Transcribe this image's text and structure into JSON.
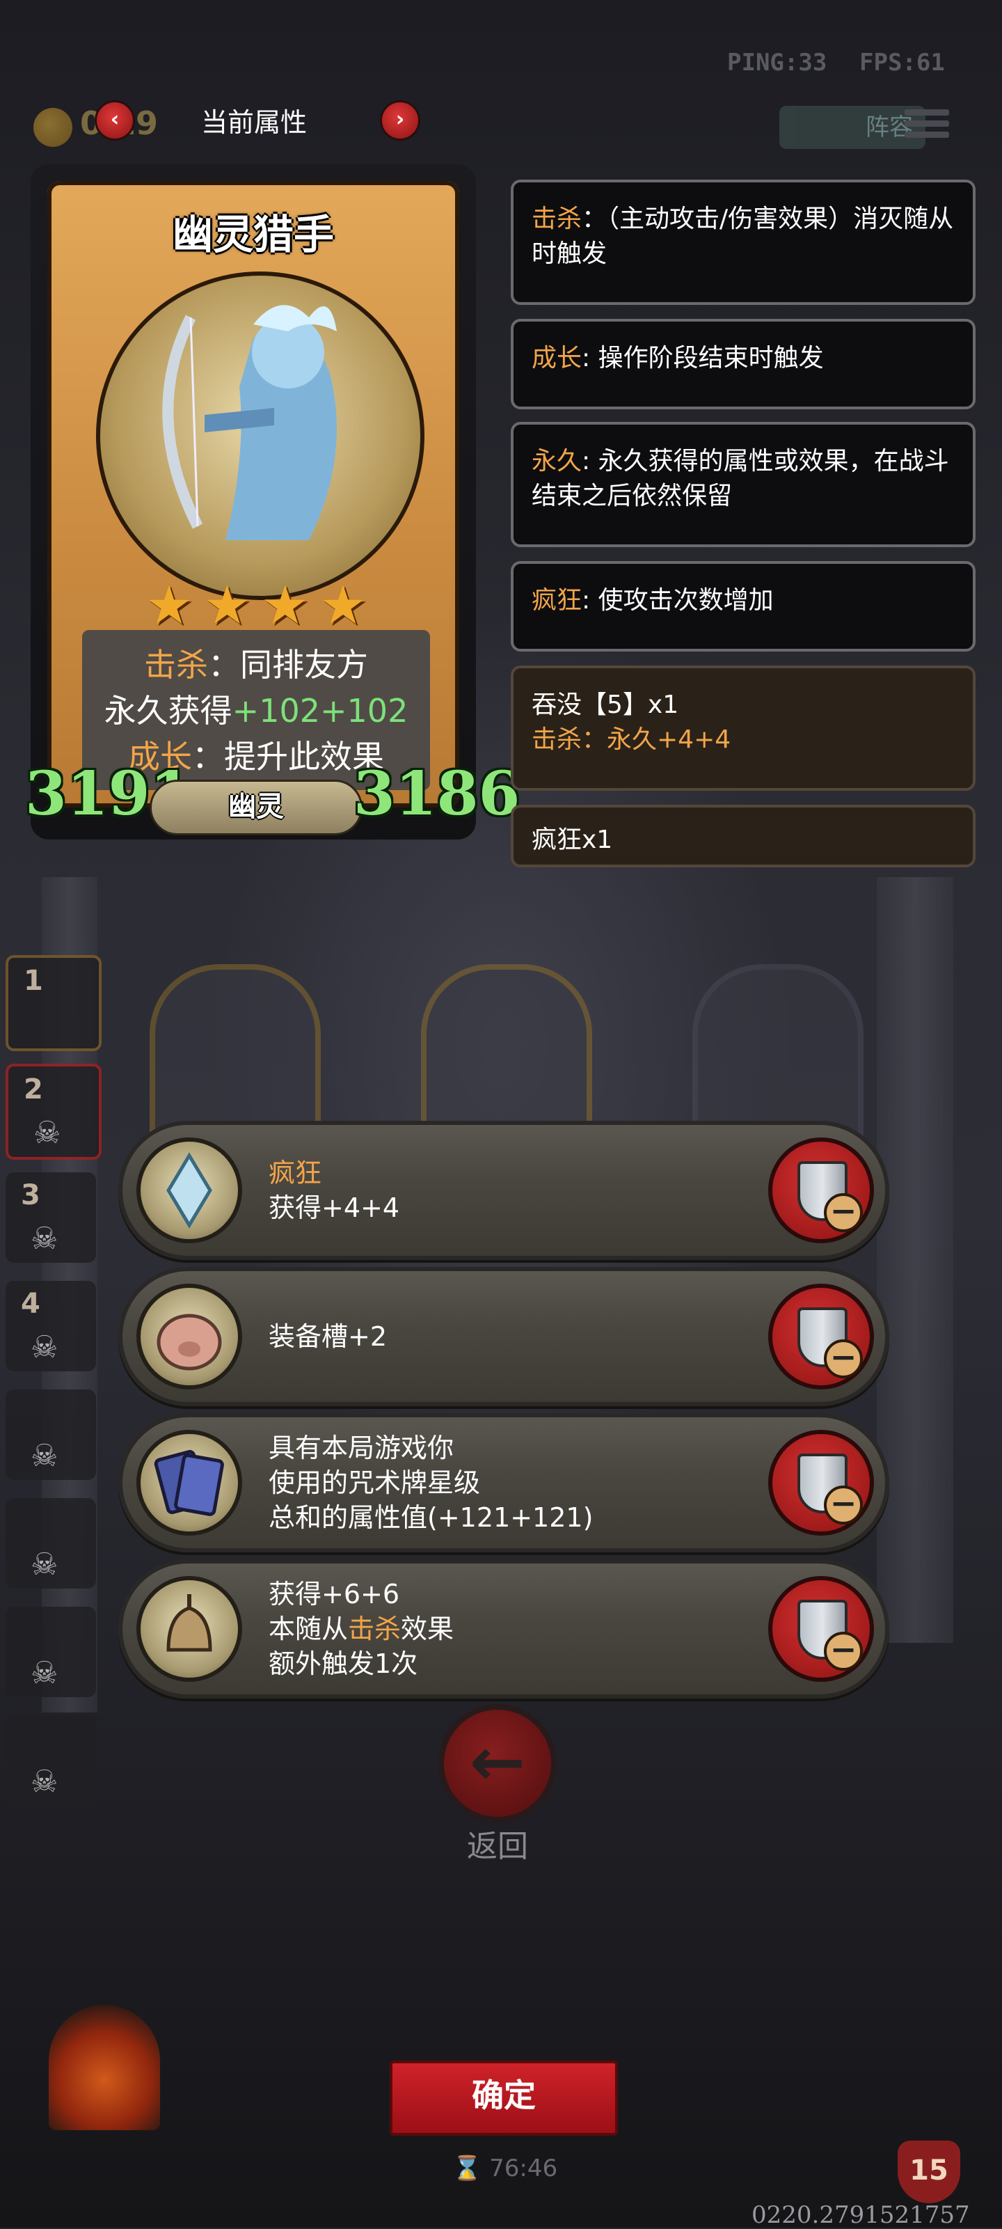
{
  "hud": {
    "ping": "PING:33",
    "fps": "FPS:61"
  },
  "header": {
    "gold": "0 19",
    "title": "当前属性",
    "prev_icon": "chevron-left-icon",
    "next_icon": "chevron-right-icon",
    "team_label": "阵容"
  },
  "card": {
    "name": "幽灵猎手",
    "stars": [
      "★",
      "★",
      "★",
      "★"
    ],
    "line1_kw": "击杀",
    "line1_rest": "：同排友方",
    "line2_a": "永久获得",
    "line2_b": "+102",
    "line2_c": "+102",
    "line3_kw": "成长",
    "line3_rest": "：提升此效果",
    "attack": "3191",
    "health": "3186",
    "tribe": "幽灵"
  },
  "glossary": [
    {
      "kw": "击杀",
      "text": "：（主动攻击/伤害效果）消灭随从时触发"
    },
    {
      "kw": "成长",
      "text": ": 操作阶段结束时触发"
    },
    {
      "kw": "永久",
      "text": ": 永久获得的属性或效果，在战斗结束之后依然保留"
    },
    {
      "kw": "疯狂",
      "text": ": 使攻击次数增加"
    }
  ],
  "buffs": [
    {
      "title": "吞没【5】x1",
      "kw": "击杀",
      "rest": "：永久+4+4"
    },
    {
      "title": "疯狂x1"
    }
  ],
  "side_slots": [
    "1",
    "2",
    "3",
    "4",
    "",
    "",
    "",
    ""
  ],
  "effects": [
    {
      "kw": "疯狂",
      "line2": "获得+4+4"
    },
    {
      "line1": "装备槽+2"
    },
    {
      "line1": "具有本局游戏你",
      "line2": "使用的咒术牌星级",
      "line3": "总和的属性值(+121+121)"
    },
    {
      "line1": "获得+6+6",
      "line2_a": "本随从",
      "line2_kw": "击杀",
      "line2_b": "效果",
      "line3": "额外触发1次"
    }
  ],
  "back_label": "返回",
  "confirm_label": "确定",
  "timer": "76:46",
  "lives": "15",
  "footer_id": "0220.2791521757",
  "colors": {
    "accent_orange": "#f2a54a",
    "stat_green": "#8ee67a",
    "button_red": "#c41a22"
  }
}
